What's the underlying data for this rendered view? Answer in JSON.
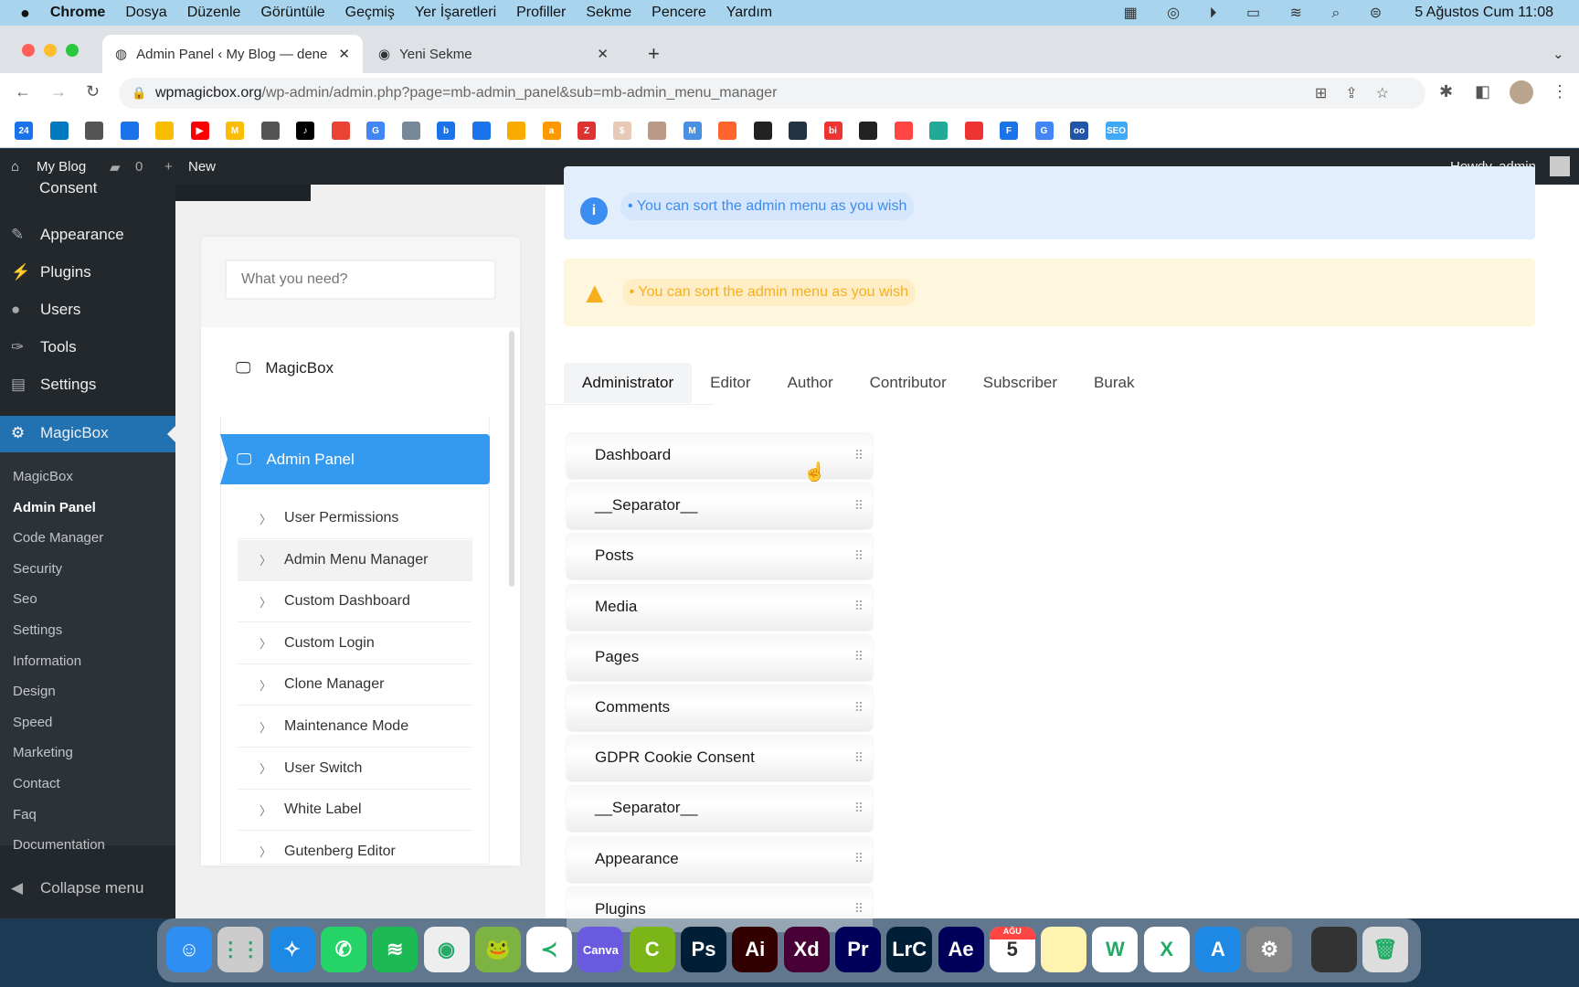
{
  "menubar": {
    "app": "Chrome",
    "items": [
      "Dosya",
      "Düzenle",
      "Görüntüle",
      "Geçmiş",
      "Yer İşaretleri",
      "Profiller",
      "Sekme",
      "Pencere",
      "Yardım"
    ],
    "clock": "5 Ağustos Cum  11:08"
  },
  "tabs": [
    {
      "title": "Admin Panel ‹ My Blog — dene"
    },
    {
      "title": "Yeni Sekme"
    }
  ],
  "address": {
    "domain": "wpmagicbox.org",
    "path": "/wp-admin/admin.php?page=mb-admin_panel&sub=mb-admin_menu_manager"
  },
  "bookmarks": [
    {
      "label": "24",
      "color": "#1a73e8"
    },
    {
      "label": "",
      "color": "#0079bf"
    },
    {
      "label": "",
      "color": "#555"
    },
    {
      "label": "",
      "color": "#1a73e8"
    },
    {
      "label": "",
      "color": "#fbbc04"
    },
    {
      "label": "▶",
      "color": "#f00"
    },
    {
      "label": "M",
      "color": "#fbbc04"
    },
    {
      "label": "",
      "color": "#555"
    },
    {
      "label": "♪",
      "color": "#000"
    },
    {
      "label": "",
      "color": "#ea4335"
    },
    {
      "label": "G",
      "color": "#4285f4"
    },
    {
      "label": "",
      "color": "#789"
    },
    {
      "label": "b",
      "color": "#1a73e8"
    },
    {
      "label": "",
      "color": "#1a73e8"
    },
    {
      "label": "",
      "color": "#f9ab00"
    },
    {
      "label": "a",
      "color": "#ff9900"
    },
    {
      "label": "Z",
      "color": "#d33"
    },
    {
      "label": "$",
      "color": "#e8c9b5"
    },
    {
      "label": "",
      "color": "#b98"
    },
    {
      "label": "M",
      "color": "#4a90e2"
    },
    {
      "label": "",
      "color": "#ff642d"
    },
    {
      "label": "",
      "color": "#222"
    },
    {
      "label": "",
      "color": "#234"
    },
    {
      "label": "bi",
      "color": "#e33"
    },
    {
      "label": "",
      "color": "#222"
    },
    {
      "label": "",
      "color": "#f44"
    },
    {
      "label": "",
      "color": "#2a9"
    },
    {
      "label": "",
      "color": "#e33"
    },
    {
      "label": "F",
      "color": "#1a73e8"
    },
    {
      "label": "G",
      "color": "#4285f4"
    },
    {
      "label": "oo",
      "color": "#2255aa"
    },
    {
      "label": "SEO",
      "color": "#3fa9f5"
    }
  ],
  "wpbar": {
    "site": "My Blog",
    "comments": "0",
    "new": "New",
    "howdy": "Howdy, admin"
  },
  "sidebar": {
    "partial": "Consent",
    "items": [
      "Appearance",
      "Plugins",
      "Users",
      "Tools",
      "Settings"
    ],
    "active": "MagicBox",
    "submenu": [
      "MagicBox",
      "Admin Panel",
      "Code Manager",
      "Security",
      "Seo",
      "Settings",
      "Information",
      "Design",
      "Speed",
      "Marketing",
      "Contact",
      "Faq",
      "Documentation"
    ],
    "collapse": "Collapse menu"
  },
  "leftpanel": {
    "search_placeholder": "What you need?",
    "top": "MagicBox",
    "active": "Admin Panel",
    "subitems": [
      "User Permissions",
      "Admin Menu Manager",
      "Custom Dashboard",
      "Custom Login",
      "Clone Manager",
      "Maintenance Mode",
      "User Switch",
      "White Label",
      "Gutenberg Editor"
    ]
  },
  "banners": {
    "info": "• You can sort the admin menu as you wish",
    "warning": "• You can sort the admin menu as you wish"
  },
  "roles": [
    "Administrator",
    "Editor",
    "Author",
    "Contributor",
    "Subscriber",
    "Burak"
  ],
  "menu_items": [
    "Dashboard",
    "__Separator__",
    "Posts",
    "Media",
    "Pages",
    "Comments",
    "GDPR Cookie Consent",
    "__Separator__",
    "Appearance",
    "Plugins"
  ],
  "dock": [
    {
      "label": "☺",
      "color": "#2e8ef2"
    },
    {
      "label": "⋮⋮",
      "color": "#ccc"
    },
    {
      "label": "✧",
      "color": "#1e88e5"
    },
    {
      "label": "✆",
      "color": "#25d366"
    },
    {
      "label": "≋",
      "color": "#1db954"
    },
    {
      "label": "◉",
      "color": "#eee"
    },
    {
      "label": "🐸",
      "color": "#7cb342"
    },
    {
      "label": "≺",
      "color": "#fff"
    },
    {
      "label": "Canva",
      "color": "#6a5ae0"
    },
    {
      "label": "C",
      "color": "#7cb518"
    },
    {
      "label": "Ps",
      "color": "#001e36"
    },
    {
      "label": "Ai",
      "color": "#330000"
    },
    {
      "label": "Xd",
      "color": "#470137"
    },
    {
      "label": "Pr",
      "color": "#00005b"
    },
    {
      "label": "LrC",
      "color": "#001e36"
    },
    {
      "label": "Ae",
      "color": "#00005b"
    },
    {
      "label": "5",
      "color": "#fff"
    },
    {
      "label": "",
      "color": "#fff3b0"
    },
    {
      "label": "W",
      "color": "#fff"
    },
    {
      "label": "X",
      "color": "#fff"
    },
    {
      "label": "A",
      "color": "#1e88e5"
    },
    {
      "label": "⚙",
      "color": "#888"
    },
    {
      "label": "",
      "color": "#333"
    },
    {
      "label": "🗑",
      "color": "#ddd"
    }
  ],
  "calendar_month": "AĞU"
}
